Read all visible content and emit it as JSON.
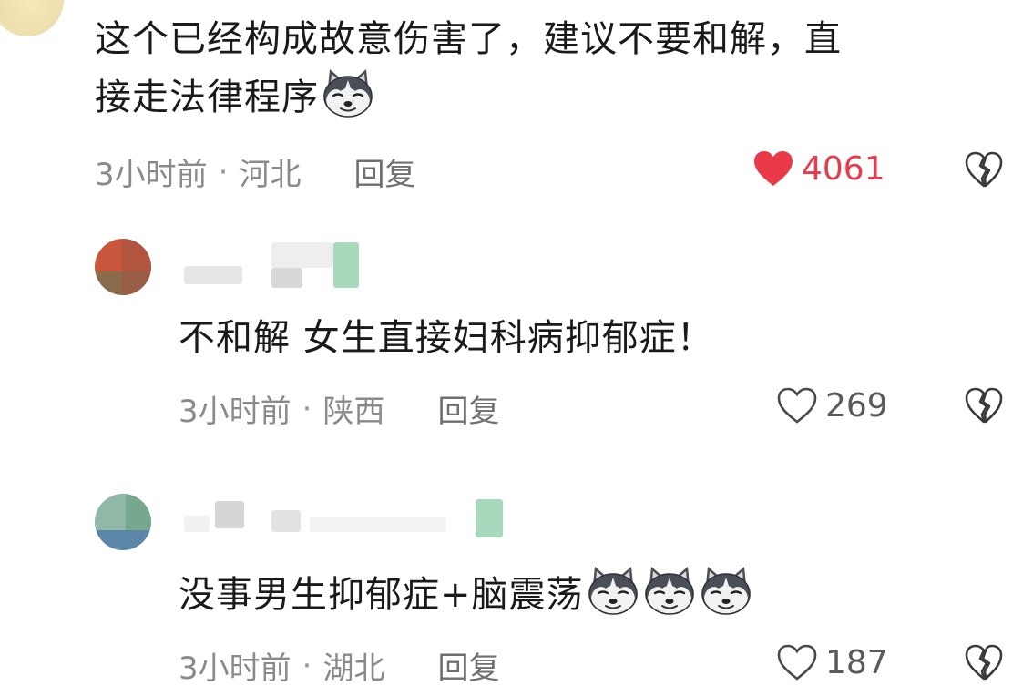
{
  "comments": [
    {
      "text": "这个已经构成故意伤害了，建议不要和解，直接走法律程序",
      "line1": "这个已经构成故意伤害了，建议不要和解，直",
      "line2": "接走法律程序",
      "time": "3小时前",
      "separator": "·",
      "location": "河北",
      "reply_label": "回复",
      "likes": "4061",
      "liked": true,
      "emoji": "husky-dog-emoji"
    },
    {
      "text": "不和解 女生直接妇科病抑郁症！",
      "time": "3小时前",
      "separator": "·",
      "location": "陕西",
      "reply_label": "回复",
      "likes": "269",
      "liked": false
    },
    {
      "text": "没事男生抑郁症+脑震荡",
      "time": "3小时前",
      "separator": "·",
      "location": "湖北",
      "reply_label": "回复",
      "likes": "187",
      "liked": false,
      "emoji": "husky-dog-emoji",
      "emoji_count": 3
    }
  ],
  "icons": {
    "like": "heart-icon",
    "dislike": "broken-heart-icon"
  },
  "colors": {
    "liked_heart": "#ea3a4a",
    "meta_text": "#8a8a8a"
  }
}
